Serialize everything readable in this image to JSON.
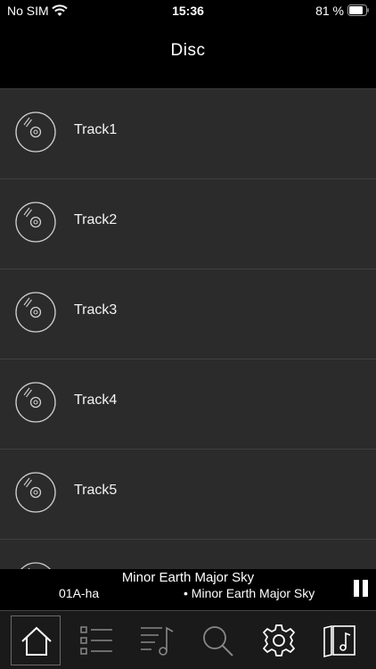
{
  "status_bar": {
    "carrier": "No SIM",
    "time": "15:36",
    "battery": "81 %"
  },
  "header": {
    "title": "Disc"
  },
  "tracks": [
    {
      "label": "Track1",
      "icon": "disc-icon"
    },
    {
      "label": "Track2",
      "icon": "disc-icon"
    },
    {
      "label": "Track3",
      "icon": "disc-icon"
    },
    {
      "label": "Track4",
      "icon": "disc-icon"
    },
    {
      "label": "Track5",
      "icon": "disc-icon"
    },
    {
      "label": "",
      "icon": "disc-icon"
    }
  ],
  "now_playing": {
    "title": "Minor Earth Major Sky",
    "track": "01A-ha",
    "album": "• Minor Earth Major Sky",
    "state_icon": "pause-icon"
  },
  "tab_bar": {
    "items": [
      {
        "icon": "home-icon",
        "active": true
      },
      {
        "icon": "list-icon",
        "active": false
      },
      {
        "icon": "playlist-icon",
        "active": false
      },
      {
        "icon": "search-icon",
        "active": false
      },
      {
        "icon": "settings-icon",
        "active": false
      },
      {
        "icon": "music-library-icon",
        "active": false
      }
    ]
  },
  "colors": {
    "background": "#2b2b2b",
    "bar": "#000000",
    "text": "#ffffff"
  }
}
